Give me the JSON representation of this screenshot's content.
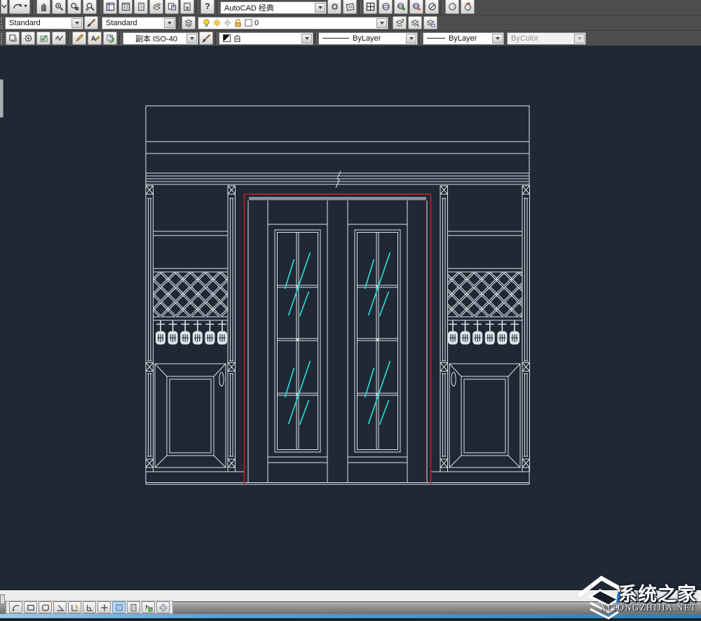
{
  "toolbars": {
    "row1": {
      "workspace": "AutoCAD 经典",
      "help": "?"
    },
    "row2": {
      "text_style": "Standard",
      "dim_style": "Standard",
      "layer": "0"
    },
    "row3": {
      "annotation_style": "副本 ISO-40",
      "color": "白",
      "linetype": "ByLayer",
      "lineweight": "ByLayer",
      "plotstyle": "ByColor"
    }
  },
  "watermark": {
    "title": "系统之家",
    "site": "XITONGZHIJIA.NET"
  },
  "colors": {
    "cad-line": "#dde3e8",
    "cad-red": "#b42424",
    "cad-cyan": "#2ad8d8",
    "cad-gray": "#8d9299",
    "canvas-bg": "#1f2834",
    "chrome-bg": "#4e4e4e"
  }
}
